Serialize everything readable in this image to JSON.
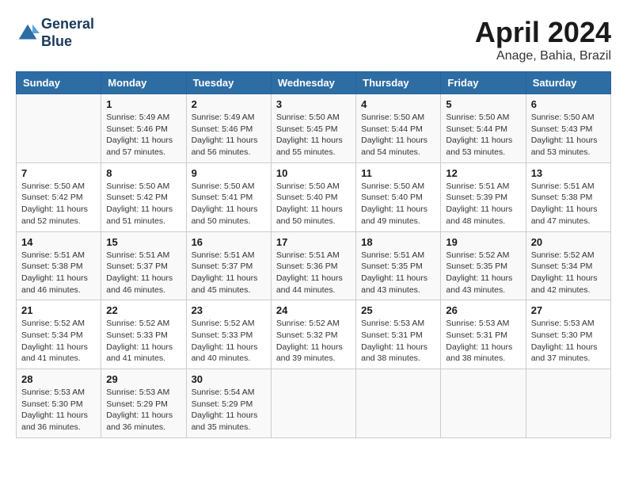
{
  "header": {
    "logo_line1": "General",
    "logo_line2": "Blue",
    "title": "April 2024",
    "subtitle": "Anage, Bahia, Brazil"
  },
  "days_of_week": [
    "Sunday",
    "Monday",
    "Tuesday",
    "Wednesday",
    "Thursday",
    "Friday",
    "Saturday"
  ],
  "weeks": [
    [
      {
        "day": "",
        "sunrise": "",
        "sunset": "",
        "daylight": ""
      },
      {
        "day": "1",
        "sunrise": "Sunrise: 5:49 AM",
        "sunset": "Sunset: 5:46 PM",
        "daylight": "Daylight: 11 hours and 57 minutes."
      },
      {
        "day": "2",
        "sunrise": "Sunrise: 5:49 AM",
        "sunset": "Sunset: 5:46 PM",
        "daylight": "Daylight: 11 hours and 56 minutes."
      },
      {
        "day": "3",
        "sunrise": "Sunrise: 5:50 AM",
        "sunset": "Sunset: 5:45 PM",
        "daylight": "Daylight: 11 hours and 55 minutes."
      },
      {
        "day": "4",
        "sunrise": "Sunrise: 5:50 AM",
        "sunset": "Sunset: 5:44 PM",
        "daylight": "Daylight: 11 hours and 54 minutes."
      },
      {
        "day": "5",
        "sunrise": "Sunrise: 5:50 AM",
        "sunset": "Sunset: 5:44 PM",
        "daylight": "Daylight: 11 hours and 53 minutes."
      },
      {
        "day": "6",
        "sunrise": "Sunrise: 5:50 AM",
        "sunset": "Sunset: 5:43 PM",
        "daylight": "Daylight: 11 hours and 53 minutes."
      }
    ],
    [
      {
        "day": "7",
        "sunrise": "Sunrise: 5:50 AM",
        "sunset": "Sunset: 5:42 PM",
        "daylight": "Daylight: 11 hours and 52 minutes."
      },
      {
        "day": "8",
        "sunrise": "Sunrise: 5:50 AM",
        "sunset": "Sunset: 5:42 PM",
        "daylight": "Daylight: 11 hours and 51 minutes."
      },
      {
        "day": "9",
        "sunrise": "Sunrise: 5:50 AM",
        "sunset": "Sunset: 5:41 PM",
        "daylight": "Daylight: 11 hours and 50 minutes."
      },
      {
        "day": "10",
        "sunrise": "Sunrise: 5:50 AM",
        "sunset": "Sunset: 5:40 PM",
        "daylight": "Daylight: 11 hours and 50 minutes."
      },
      {
        "day": "11",
        "sunrise": "Sunrise: 5:50 AM",
        "sunset": "Sunset: 5:40 PM",
        "daylight": "Daylight: 11 hours and 49 minutes."
      },
      {
        "day": "12",
        "sunrise": "Sunrise: 5:51 AM",
        "sunset": "Sunset: 5:39 PM",
        "daylight": "Daylight: 11 hours and 48 minutes."
      },
      {
        "day": "13",
        "sunrise": "Sunrise: 5:51 AM",
        "sunset": "Sunset: 5:38 PM",
        "daylight": "Daylight: 11 hours and 47 minutes."
      }
    ],
    [
      {
        "day": "14",
        "sunrise": "Sunrise: 5:51 AM",
        "sunset": "Sunset: 5:38 PM",
        "daylight": "Daylight: 11 hours and 46 minutes."
      },
      {
        "day": "15",
        "sunrise": "Sunrise: 5:51 AM",
        "sunset": "Sunset: 5:37 PM",
        "daylight": "Daylight: 11 hours and 46 minutes."
      },
      {
        "day": "16",
        "sunrise": "Sunrise: 5:51 AM",
        "sunset": "Sunset: 5:37 PM",
        "daylight": "Daylight: 11 hours and 45 minutes."
      },
      {
        "day": "17",
        "sunrise": "Sunrise: 5:51 AM",
        "sunset": "Sunset: 5:36 PM",
        "daylight": "Daylight: 11 hours and 44 minutes."
      },
      {
        "day": "18",
        "sunrise": "Sunrise: 5:51 AM",
        "sunset": "Sunset: 5:35 PM",
        "daylight": "Daylight: 11 hours and 43 minutes."
      },
      {
        "day": "19",
        "sunrise": "Sunrise: 5:52 AM",
        "sunset": "Sunset: 5:35 PM",
        "daylight": "Daylight: 11 hours and 43 minutes."
      },
      {
        "day": "20",
        "sunrise": "Sunrise: 5:52 AM",
        "sunset": "Sunset: 5:34 PM",
        "daylight": "Daylight: 11 hours and 42 minutes."
      }
    ],
    [
      {
        "day": "21",
        "sunrise": "Sunrise: 5:52 AM",
        "sunset": "Sunset: 5:34 PM",
        "daylight": "Daylight: 11 hours and 41 minutes."
      },
      {
        "day": "22",
        "sunrise": "Sunrise: 5:52 AM",
        "sunset": "Sunset: 5:33 PM",
        "daylight": "Daylight: 11 hours and 41 minutes."
      },
      {
        "day": "23",
        "sunrise": "Sunrise: 5:52 AM",
        "sunset": "Sunset: 5:33 PM",
        "daylight": "Daylight: 11 hours and 40 minutes."
      },
      {
        "day": "24",
        "sunrise": "Sunrise: 5:52 AM",
        "sunset": "Sunset: 5:32 PM",
        "daylight": "Daylight: 11 hours and 39 minutes."
      },
      {
        "day": "25",
        "sunrise": "Sunrise: 5:53 AM",
        "sunset": "Sunset: 5:31 PM",
        "daylight": "Daylight: 11 hours and 38 minutes."
      },
      {
        "day": "26",
        "sunrise": "Sunrise: 5:53 AM",
        "sunset": "Sunset: 5:31 PM",
        "daylight": "Daylight: 11 hours and 38 minutes."
      },
      {
        "day": "27",
        "sunrise": "Sunrise: 5:53 AM",
        "sunset": "Sunset: 5:30 PM",
        "daylight": "Daylight: 11 hours and 37 minutes."
      }
    ],
    [
      {
        "day": "28",
        "sunrise": "Sunrise: 5:53 AM",
        "sunset": "Sunset: 5:30 PM",
        "daylight": "Daylight: 11 hours and 36 minutes."
      },
      {
        "day": "29",
        "sunrise": "Sunrise: 5:53 AM",
        "sunset": "Sunset: 5:29 PM",
        "daylight": "Daylight: 11 hours and 36 minutes."
      },
      {
        "day": "30",
        "sunrise": "Sunrise: 5:54 AM",
        "sunset": "Sunset: 5:29 PM",
        "daylight": "Daylight: 11 hours and 35 minutes."
      },
      {
        "day": "",
        "sunrise": "",
        "sunset": "",
        "daylight": ""
      },
      {
        "day": "",
        "sunrise": "",
        "sunset": "",
        "daylight": ""
      },
      {
        "day": "",
        "sunrise": "",
        "sunset": "",
        "daylight": ""
      },
      {
        "day": "",
        "sunrise": "",
        "sunset": "",
        "daylight": ""
      }
    ]
  ]
}
